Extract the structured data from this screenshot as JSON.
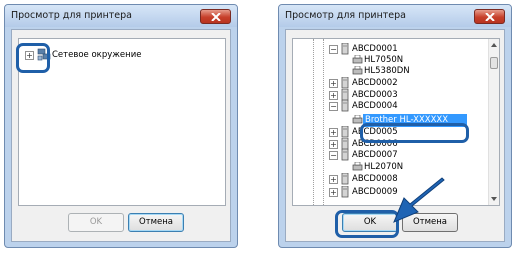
{
  "left_dialog": {
    "title": "Просмотр для принтера",
    "tree_root": "Сетевое окружение",
    "ok_label": "OK",
    "cancel_label": "Отмена"
  },
  "right_dialog": {
    "title": "Просмотр для принтера",
    "tree": [
      {
        "label": "ABCD0001",
        "type": "computer",
        "expanded": true
      },
      {
        "label": "HL7050N",
        "type": "printer"
      },
      {
        "label": "HL5380DN",
        "type": "printer"
      },
      {
        "label": "ABCD0002",
        "type": "computer",
        "expanded": false
      },
      {
        "label": "ABCD0003",
        "type": "computer",
        "expanded": false
      },
      {
        "label": "ABCD0004",
        "type": "computer",
        "expanded": true
      },
      {
        "label": "Brother HL-XXXXXX",
        "type": "printer",
        "selected": true
      },
      {
        "label": "ABCD0005",
        "type": "computer",
        "expanded": false
      },
      {
        "label": "ABCD0006",
        "type": "computer",
        "expanded": false
      },
      {
        "label": "ABCD0007",
        "type": "computer",
        "expanded": true
      },
      {
        "label": "HL2070N",
        "type": "printer"
      },
      {
        "label": "ABCD0008",
        "type": "computer",
        "expanded": false
      },
      {
        "label": "ABCD0009",
        "type": "computer",
        "expanded": false
      }
    ],
    "ok_label": "OK",
    "cancel_label": "Отмена"
  },
  "colors": {
    "highlight_ring": "#1f5fa8",
    "pointer_arrow": "#1f64b4",
    "selection": "#3399ff"
  }
}
